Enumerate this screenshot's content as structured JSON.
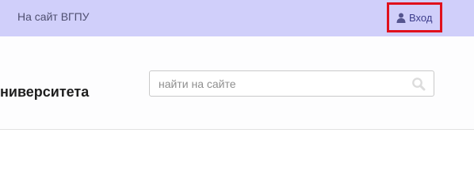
{
  "topbar": {
    "site_link_label": "На сайт ВГПУ",
    "login_label": "Вход",
    "login_icon": "user-icon",
    "background_color": "#d0cffa",
    "highlight_color": "#e0101c"
  },
  "header": {
    "title_fragment": "ниверситета"
  },
  "search": {
    "placeholder": "найти на сайте",
    "value": "",
    "icon": "search-icon"
  }
}
